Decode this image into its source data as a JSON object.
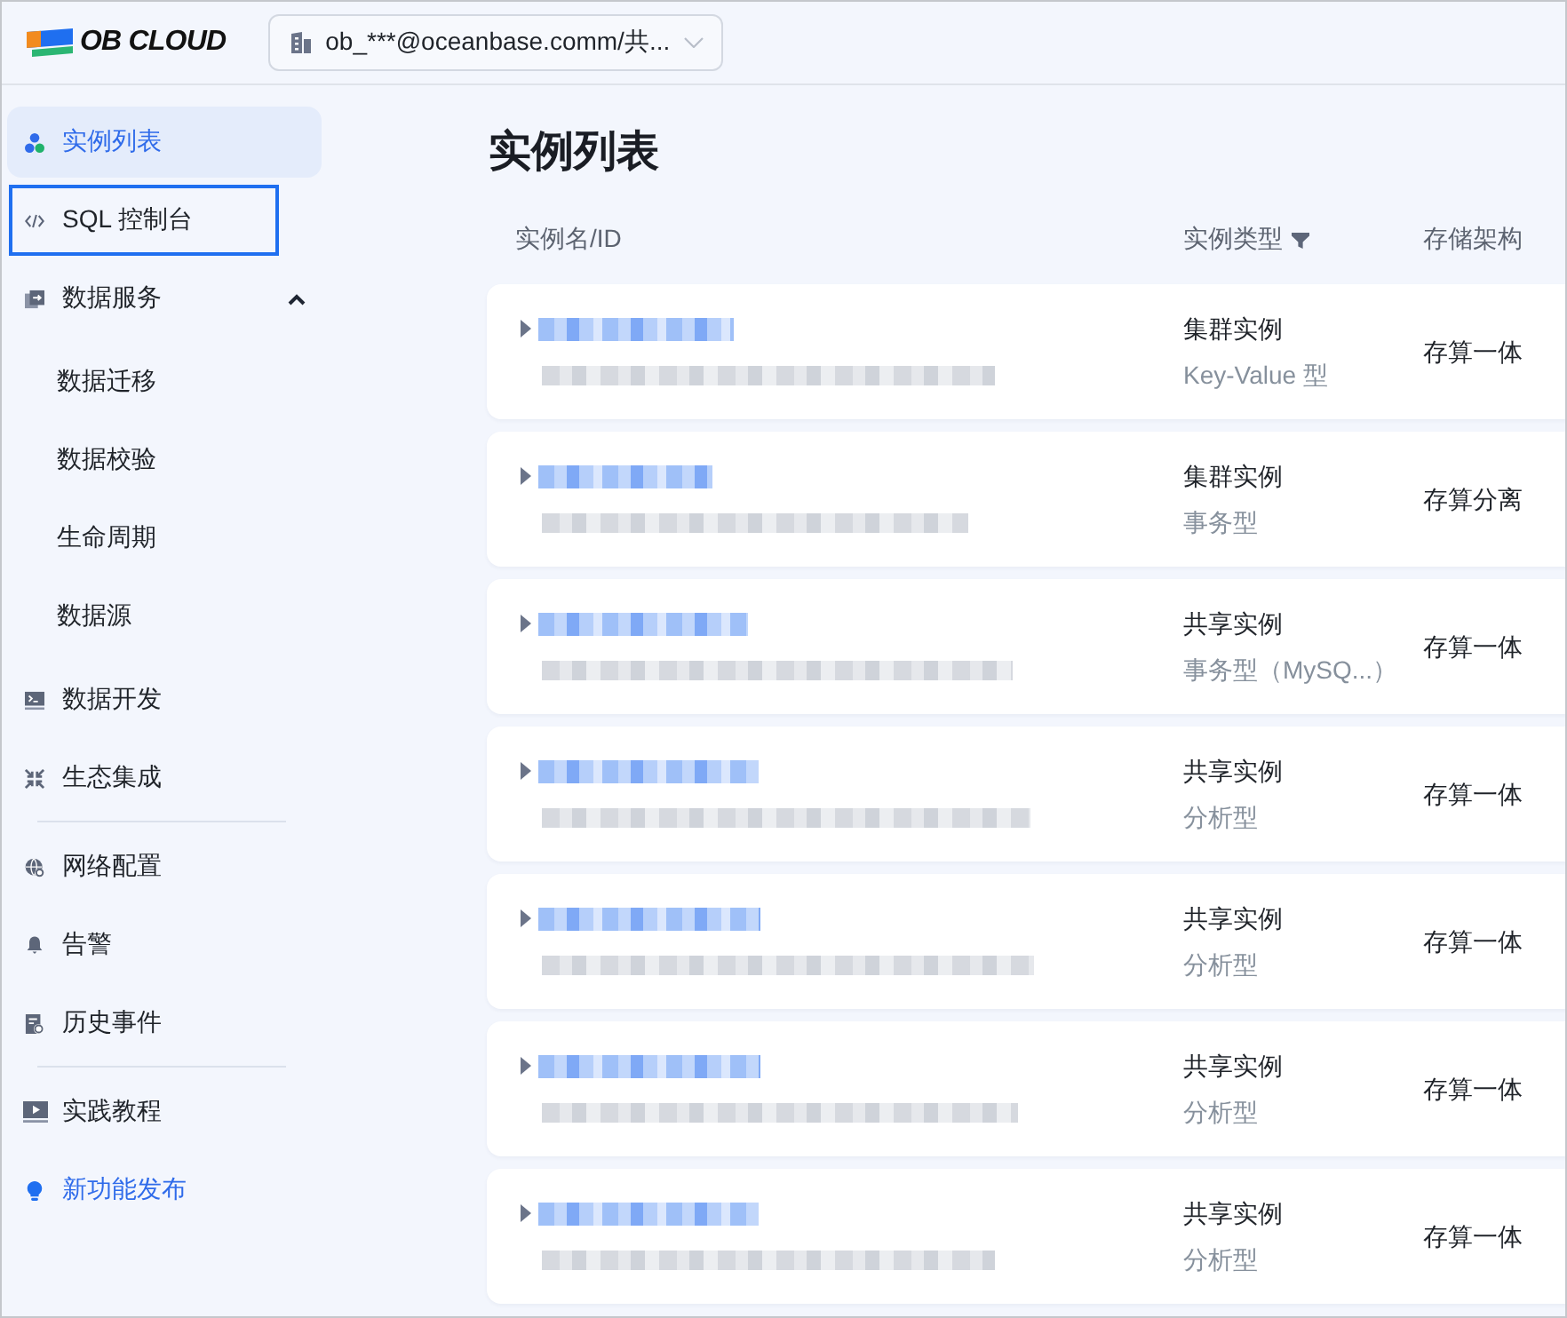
{
  "header": {
    "logo_text": "OB CLOUD",
    "account_selector": {
      "value": "ob_***@oceanbase.comm/共..."
    }
  },
  "sidebar": {
    "sections": [
      {
        "items": [
          {
            "label": "实例列表",
            "kind": "nav",
            "selected": true,
            "focused": false
          },
          {
            "label": "SQL 控制台",
            "kind": "nav",
            "selected": false,
            "focused": true
          },
          {
            "label": "数据服务",
            "kind": "group",
            "selected": false,
            "focused": false,
            "expanded": true,
            "children": [
              {
                "label": "数据迁移",
                "selected": false
              },
              {
                "label": "数据校验",
                "selected": false
              },
              {
                "label": "生命周期",
                "selected": false
              },
              {
                "label": "数据源",
                "selected": false
              }
            ]
          },
          {
            "label": "数据开发",
            "kind": "nav",
            "selected": false,
            "focused": false
          },
          {
            "label": "生态集成",
            "kind": "nav",
            "selected": false,
            "focused": false
          }
        ]
      },
      {
        "items": [
          {
            "label": "网络配置",
            "kind": "nav",
            "selected": false,
            "focused": false
          },
          {
            "label": "告警",
            "kind": "nav",
            "selected": false,
            "focused": false
          },
          {
            "label": "历史事件",
            "kind": "nav",
            "selected": false,
            "focused": false
          }
        ]
      },
      {
        "items": [
          {
            "label": "实践教程",
            "kind": "nav",
            "selected": false,
            "focused": false
          },
          {
            "label": "新功能发布",
            "kind": "promo",
            "selected": false,
            "focused": false
          }
        ]
      }
    ]
  },
  "main": {
    "title": "实例列表",
    "columns": [
      {
        "label": "实例名/ID",
        "filterable": false
      },
      {
        "label": "实例类型",
        "filterable": true
      },
      {
        "label": "存储架构",
        "filterable": false
      }
    ],
    "rows": [
      {
        "expanded": false,
        "instance_type": "集群实例",
        "type_detail": "Key-Value 型",
        "storage": "存算一体"
      },
      {
        "expanded": false,
        "instance_type": "集群实例",
        "type_detail": "事务型",
        "storage": "存算分离"
      },
      {
        "expanded": false,
        "instance_type": "共享实例",
        "type_detail": "事务型（MySQ...）",
        "storage": "存算一体"
      },
      {
        "expanded": false,
        "instance_type": "共享实例",
        "type_detail": "分析型",
        "storage": "存算一体"
      },
      {
        "expanded": false,
        "instance_type": "共享实例",
        "type_detail": "分析型",
        "storage": "存算一体"
      },
      {
        "expanded": false,
        "instance_type": "共享实例",
        "type_detail": "分析型",
        "storage": "存算一体"
      },
      {
        "expanded": false,
        "instance_type": "共享实例",
        "type_detail": "分析型",
        "storage": "存算一体"
      }
    ]
  }
}
